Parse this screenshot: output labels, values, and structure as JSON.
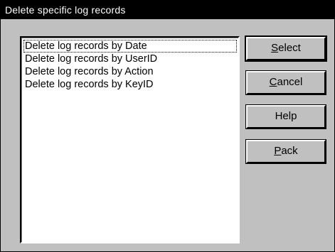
{
  "dialog": {
    "title": "Delete specific log records"
  },
  "list": {
    "items": [
      "Delete log records by Date",
      "Delete log records by UserID",
      "Delete log records by Action",
      "Delete log records by KeyID"
    ]
  },
  "buttons": {
    "select": {
      "mnemonic": "S",
      "rest": "elect"
    },
    "cancel": {
      "mnemonic": "C",
      "rest": "ancel"
    },
    "help": {
      "label": "Help"
    },
    "pack": {
      "mnemonic": "P",
      "rest": "ack"
    }
  }
}
